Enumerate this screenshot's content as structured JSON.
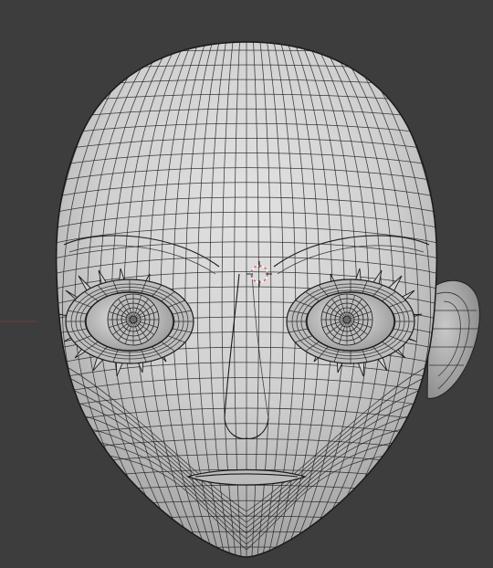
{
  "viewport": {
    "mode": "3d-viewport",
    "shading": "solid-wireframe-overlay",
    "background_color": "#3d3d3d",
    "mesh_color": "#c8c8c8",
    "wire_color": "#1f1f1f",
    "object": "head-mesh",
    "cursor": "3d-cursor-icon"
  }
}
